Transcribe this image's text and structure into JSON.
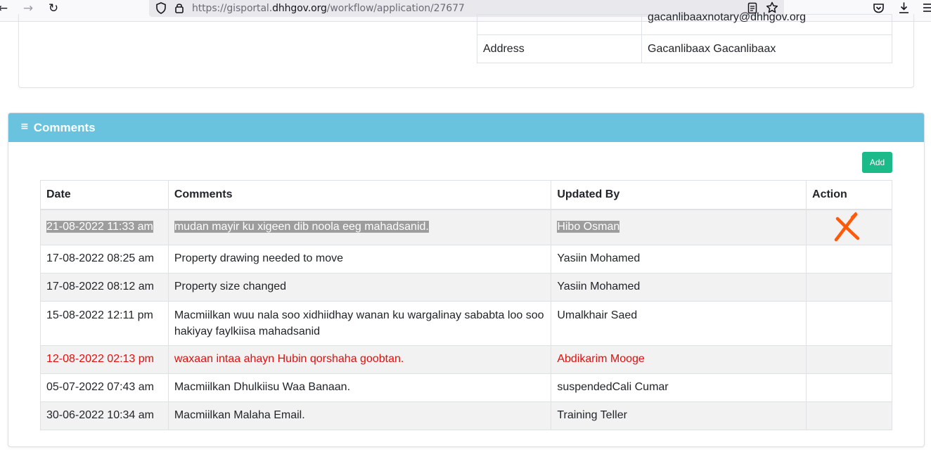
{
  "browser": {
    "url_prefix": "https://gisportal.",
    "url_domain": "dhhgov.org",
    "url_path": "/workflow/application/27677"
  },
  "contact": {
    "rows": [
      {
        "label": "",
        "value": "gacanlibaaxnotary@dhhgov.org"
      },
      {
        "label": "Address",
        "value": "Gacanlibaax Gacanlibaax"
      }
    ]
  },
  "comments": {
    "title": "Comments",
    "add_label": "Add",
    "headers": [
      "Date",
      "Comments",
      "Updated By",
      "Action"
    ],
    "rows": [
      {
        "date": "21-08-2022 11:33 am",
        "comment": "mudan mayir ku xigeen dib noola eeg mahadsanid.",
        "updated_by": "Hibo Osman"
      },
      {
        "date": "17-08-2022 08:25 am",
        "comment": "Property drawing needed to move",
        "updated_by": "Yasiin Mohamed"
      },
      {
        "date": "17-08-2022 08:12 am",
        "comment": "Property size changed",
        "updated_by": "Yasiin Mohamed"
      },
      {
        "date": "15-08-2022 12:11 pm",
        "comment": "Macmiilkan wuu nala soo xidhiidhay wanan ku wargalinay sababta loo soo hakiyay faylkiisa mahadsanid",
        "updated_by": "Umalkhair Saed"
      },
      {
        "date": "12-08-2022 02:13 pm",
        "comment": "waxaan intaa ahayn Hubin qorshaha goobtan.",
        "updated_by": "Abdikarim Mooge"
      },
      {
        "date": "05-07-2022 07:43 am",
        "comment": "Macmiilkan Dhulkiisu Waa Banaan.",
        "updated_by": "suspendedCali Cumar"
      },
      {
        "date": "30-06-2022 10:34 am",
        "comment": "Macmiilkan Malaha Email.",
        "updated_by": "Training Teller"
      }
    ],
    "highlight_color": "#9d9d9d",
    "red_row_color": "#e00f0f",
    "x_mark_color": "#ff5a0a",
    "header_color": "#69c3df",
    "add_button_color": "#1cb989"
  }
}
